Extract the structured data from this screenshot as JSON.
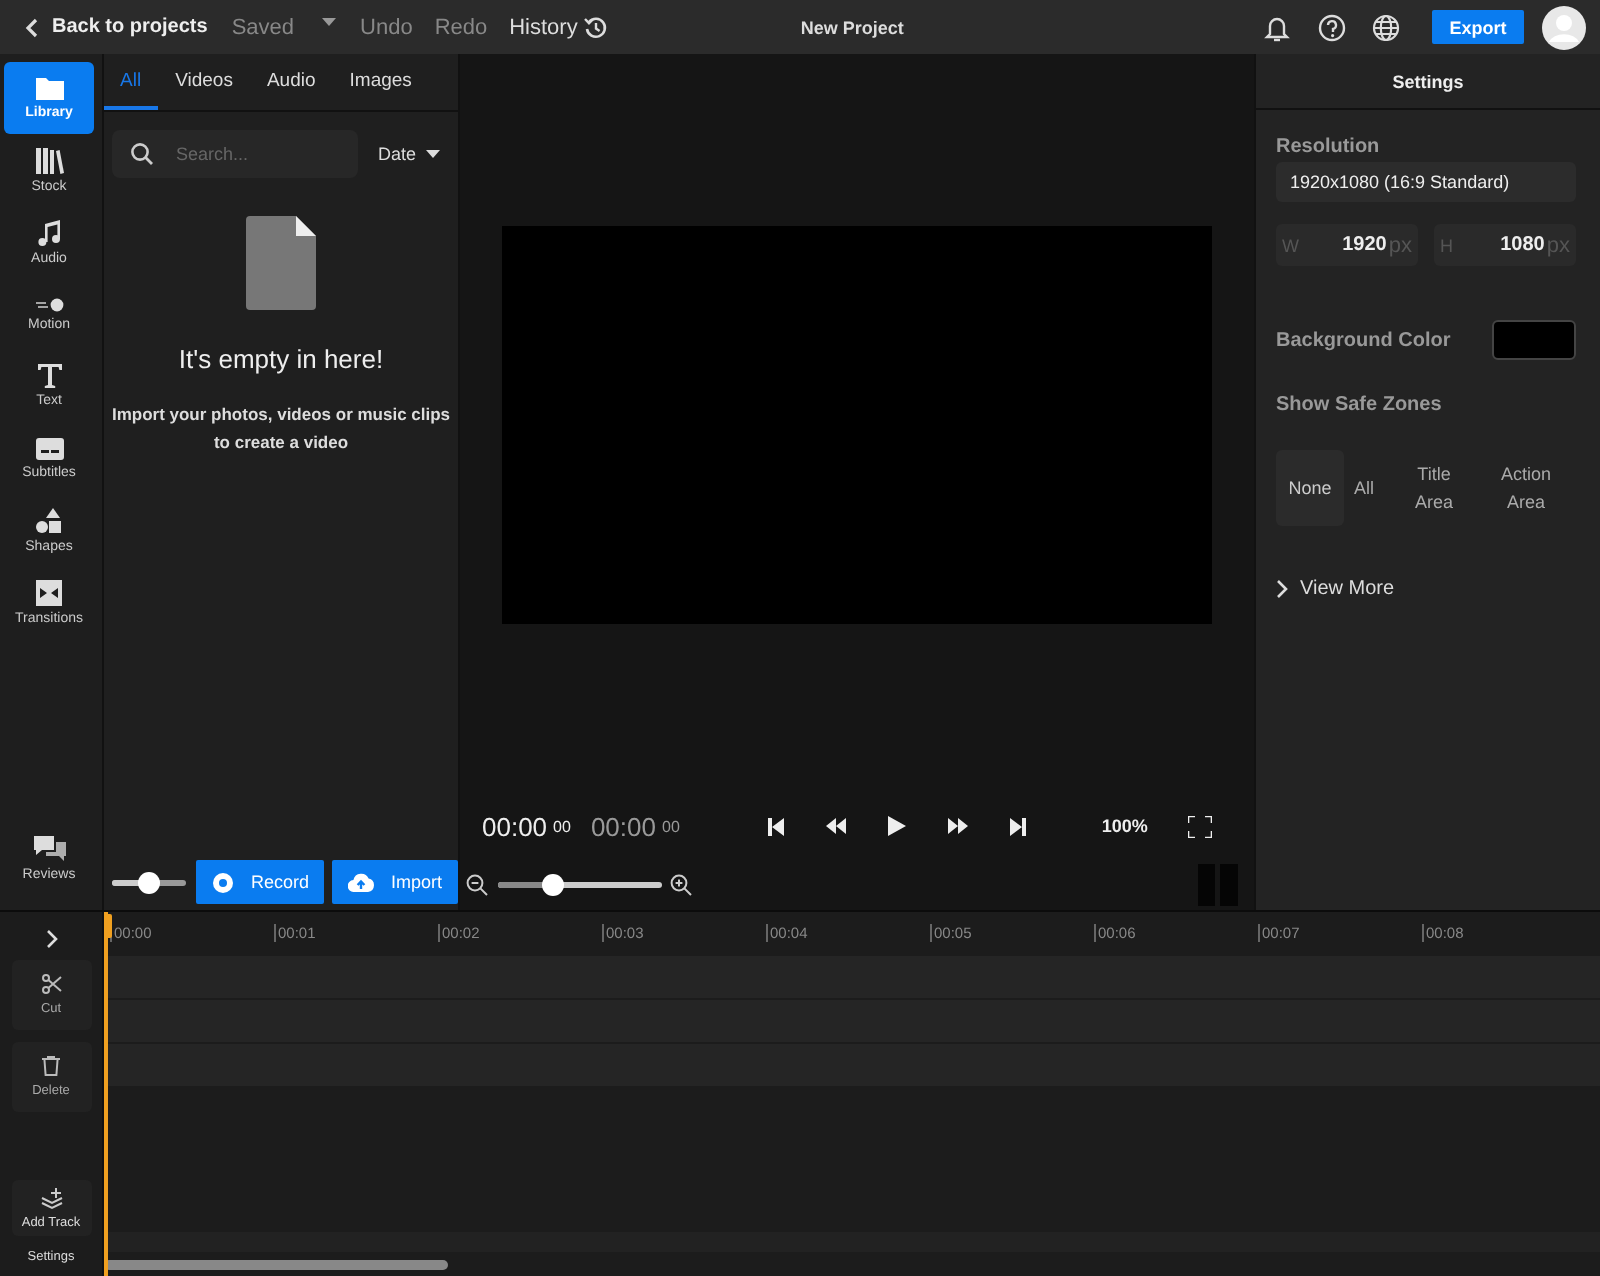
{
  "topbar": {
    "back": "Back to projects",
    "status": "Saved",
    "undo": "Undo",
    "redo": "Redo",
    "history": "History",
    "title": "New Project",
    "export": "Export"
  },
  "rail": {
    "items": [
      {
        "label": "Library",
        "selected": true
      },
      {
        "label": "Stock",
        "selected": false
      },
      {
        "label": "Audio",
        "selected": false
      },
      {
        "label": "Motion",
        "selected": false
      },
      {
        "label": "Text",
        "selected": false
      },
      {
        "label": "Subtitles",
        "selected": false
      },
      {
        "label": "Shapes",
        "selected": false
      },
      {
        "label": "Transitions",
        "selected": false
      }
    ],
    "bottom_item": "Reviews"
  },
  "library": {
    "tabs": [
      {
        "label": "All",
        "selected": true
      },
      {
        "label": "Videos",
        "selected": false
      },
      {
        "label": "Audio",
        "selected": false
      },
      {
        "label": "Images",
        "selected": false
      }
    ],
    "search": {
      "placeholder": "Search..."
    },
    "sort": "Date",
    "empty_title": "It's empty in here!",
    "empty_text": "Import your photos, videos or music clips to create a video",
    "volume": {
      "level": 0.5
    },
    "record": "Record",
    "import": "Import"
  },
  "preview": {
    "current_time": "00:00",
    "current_frames": "00",
    "total_time": "00:00",
    "total_frames": "00",
    "zoom": "100%",
    "timeline_zoom": {
      "level": 0.33
    }
  },
  "settings": {
    "title": "Settings",
    "resolution_label": "Resolution",
    "resolution": "1920x1080 (16:9 Standard)",
    "width": {
      "prefix": "W",
      "value": "1920",
      "unit": "px"
    },
    "height": {
      "prefix": "H",
      "value": "1080",
      "unit": "px"
    },
    "background_label": "Background Color",
    "safe_zones_label": "Show Safe Zones",
    "safe_zones": [
      {
        "label": "None",
        "selected": true
      },
      {
        "label": "All",
        "selected": false
      },
      {
        "label": "Title Area",
        "selected": false
      },
      {
        "label": "Action Area",
        "selected": false
      }
    ],
    "view_more": "View More"
  },
  "timeline": {
    "ruler": [
      "00:00",
      "00:01",
      "00:02",
      "00:03",
      "00:04",
      "00:05",
      "00:06",
      "00:07",
      "00:08"
    ],
    "tools": [
      {
        "label": "Cut"
      },
      {
        "label": "Delete"
      }
    ],
    "add_track": "Add Track",
    "settings": "Settings"
  }
}
